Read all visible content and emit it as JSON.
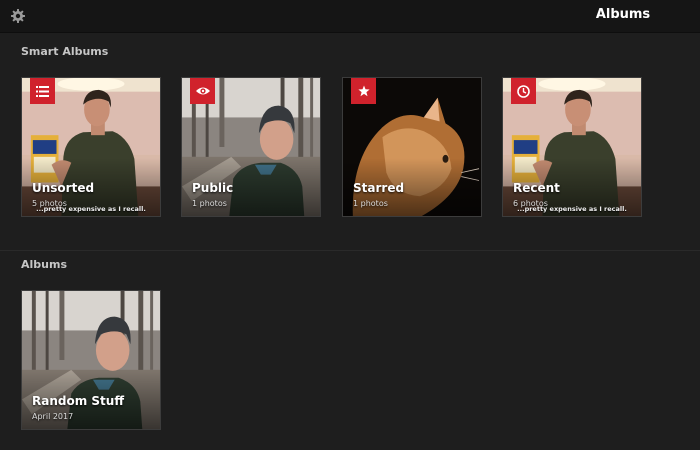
{
  "header": {
    "title": "Albums",
    "settings_icon": "gear-icon"
  },
  "smart_albums": {
    "label": "Smart Albums",
    "items": [
      {
        "name": "Unsorted",
        "subtitle": "5 photos",
        "caption": "...pretty expensive as I recall.",
        "icon": "list-icon"
      },
      {
        "name": "Public",
        "subtitle": "1 photos",
        "icon": "eye-icon"
      },
      {
        "name": "Starred",
        "subtitle": "1 photos",
        "icon": "star-icon"
      },
      {
        "name": "Recent",
        "subtitle": "6 photos",
        "caption": "...pretty expensive as I recall.",
        "icon": "clock-icon"
      }
    ]
  },
  "albums": {
    "label": "Albums",
    "items": [
      {
        "name": "Random Stuff",
        "subtitle": "April 2017"
      }
    ]
  },
  "colors": {
    "background": "#1e1e1e",
    "header": "#151515",
    "badge": "#d0222c"
  }
}
